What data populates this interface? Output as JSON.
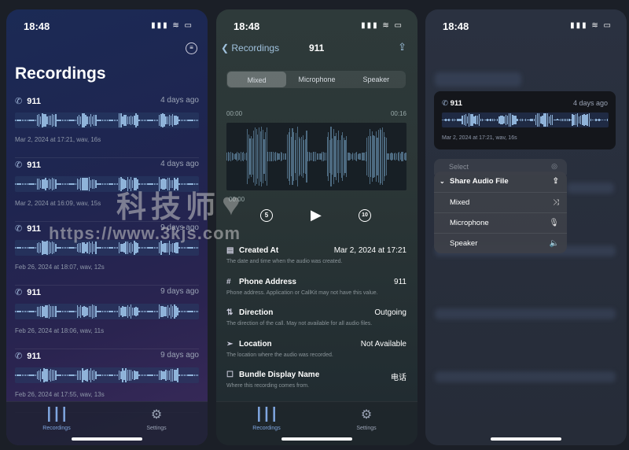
{
  "status": {
    "time": "18:48"
  },
  "list": {
    "title": "Recordings",
    "items": [
      {
        "name": "911",
        "ago": "4 days ago",
        "meta": "Mar 2, 2024 at 17:21, wav, 16s"
      },
      {
        "name": "911",
        "ago": "4 days ago",
        "meta": "Mar 2, 2024 at 16:09, wav, 15s"
      },
      {
        "name": "911",
        "ago": "9 days ago",
        "meta": "Feb 26, 2024 at 18:07, wav, 12s"
      },
      {
        "name": "911",
        "ago": "9 days ago",
        "meta": "Feb 26, 2024 at 18:06, wav, 11s"
      },
      {
        "name": "911",
        "ago": "9 days ago",
        "meta": "Feb 26, 2024 at 17:55, wav, 13s"
      }
    ]
  },
  "tabs": [
    {
      "label": "Recordings",
      "icon": "waveform-icon"
    },
    {
      "label": "Settings",
      "icon": "gear-icon"
    }
  ],
  "detail": {
    "back": "Recordings",
    "title": "911",
    "segments": [
      "Mixed",
      "Microphone",
      "Speaker"
    ],
    "selected": "Mixed",
    "start": "00:00",
    "end": "00:16",
    "current": "00:00",
    "skip_back": "5",
    "skip_fwd": "10",
    "fields": [
      {
        "icon": "▤",
        "label": "Created At",
        "value": "Mar 2, 2024 at 17:21",
        "desc": "The date and time when the audio was created."
      },
      {
        "icon": "#",
        "label": "Phone Address",
        "value": "911",
        "desc": "Phone address. Application or CallKit may not have this value."
      },
      {
        "icon": "⇅",
        "label": "Direction",
        "value": "Outgoing",
        "desc": "The direction of the call. May not available for all audio files."
      },
      {
        "icon": "➢",
        "label": "Location",
        "value": "Not Available",
        "desc": "The location where the audio was recorded."
      },
      {
        "icon": "☐",
        "label": "Bundle Display Name",
        "value": "电话",
        "desc": "Where this recording comes from."
      }
    ]
  },
  "context": {
    "card": {
      "name": "911",
      "ago": "4 days ago",
      "meta": "Mar 2, 2024 at 17:21, wav, 16s"
    },
    "select": "Select",
    "share": "Share Audio File",
    "options": [
      {
        "label": "Mixed",
        "icon": "⤨"
      },
      {
        "label": "Microphone",
        "icon": "🎙"
      },
      {
        "label": "Speaker",
        "icon": "🔈"
      }
    ]
  },
  "watermark": {
    "cn": "科技师",
    "url": "https://www.3kjs.com"
  },
  "colors": {
    "accent": "#7fa6e0",
    "wave": "#8fb3d9"
  }
}
